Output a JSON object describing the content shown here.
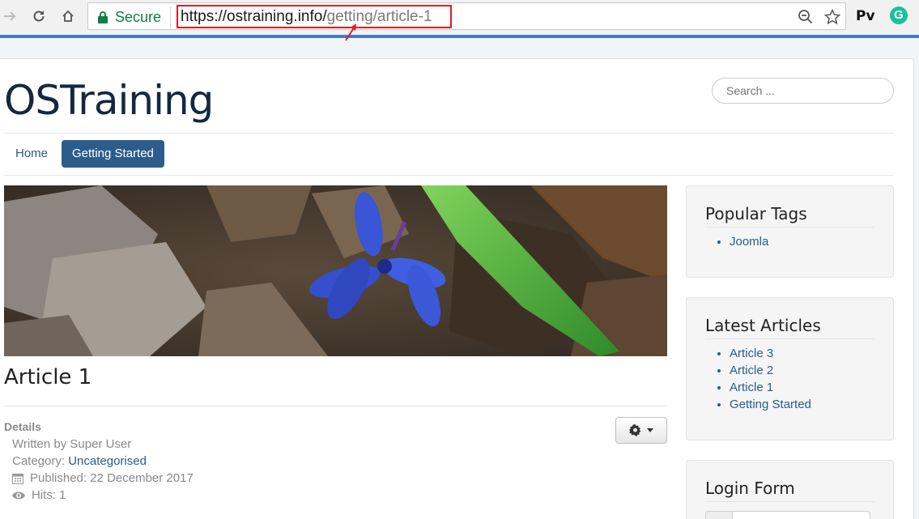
{
  "browser": {
    "secure_label": "Secure",
    "url_host": "https://ostraining.info/",
    "url_path": "getting/article-1",
    "extensions": [
      "Pv",
      "G"
    ],
    "accent_color": "#3c7fc4",
    "annotation_color": "#e11b22"
  },
  "site": {
    "title": "OSTraining",
    "search_placeholder": "Search ..."
  },
  "nav": {
    "items": [
      {
        "label": "Home",
        "active": false
      },
      {
        "label": "Getting Started",
        "active": true
      }
    ]
  },
  "article": {
    "title": "Article 1",
    "details_heading": "Details",
    "written_by": "Written by Super User",
    "category_prefix": "Category: ",
    "category": "Uncategorised",
    "published": "Published: 22 December 2017",
    "hits": "Hits: 1"
  },
  "sidebar": {
    "popular_tags": {
      "title": "Popular Tags",
      "items": [
        "Joomla"
      ]
    },
    "latest_articles": {
      "title": "Latest Articles",
      "items": [
        "Article 3",
        "Article 2",
        "Article 1",
        "Getting Started"
      ]
    },
    "login_form": {
      "title": "Login Form"
    }
  }
}
